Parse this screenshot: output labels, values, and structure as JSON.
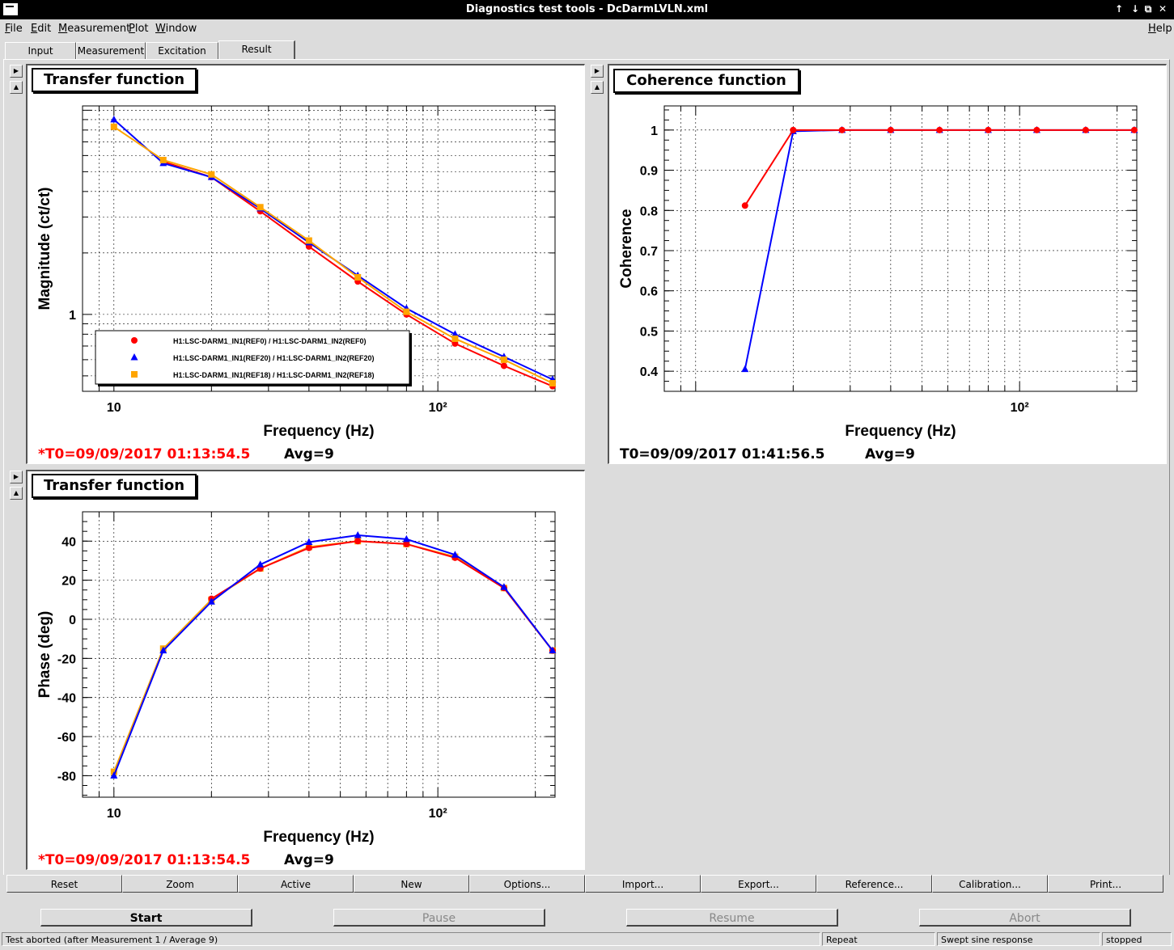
{
  "window": {
    "title": "Diagnostics test tools - DcDarmLVLN.xml",
    "controls": [
      "↑",
      "↓",
      "⧉",
      "✕"
    ]
  },
  "menu": [
    "File",
    "Edit",
    "Measurement",
    "Plot",
    "Window",
    "Help"
  ],
  "tabs": [
    "Input",
    "Measurement",
    "Excitation",
    "Result"
  ],
  "active_tab": "Result",
  "panels": {
    "tf_mag": {
      "title": "Transfer function",
      "t0": "*T0=09/09/2017 01:13:54.5",
      "avg": "Avg=9",
      "t0_color": "#ff0000"
    },
    "coh": {
      "title": "Coherence function",
      "t0": "T0=09/09/2017 01:41:56.5",
      "avg": "Avg=9",
      "t0_color": "#000000"
    },
    "tf_phase": {
      "title": "Transfer function",
      "t0": "*T0=09/09/2017 01:13:54.5",
      "avg": "Avg=9",
      "t0_color": "#ff0000"
    }
  },
  "chart_data": [
    {
      "type": "line",
      "xlabel": "Frequency (Hz)",
      "ylabel": "Magnitude (ct/ct)",
      "xscale": "log",
      "yscale": "log",
      "xlim": [
        8,
        230
      ],
      "ylim": [
        0.42,
        10.5
      ],
      "x_tick_labels": [
        "10",
        "10²"
      ],
      "y_tick_labels": [
        "1"
      ],
      "x": [
        10,
        14.2,
        20,
        28.3,
        40,
        56.6,
        80,
        113,
        160,
        226
      ],
      "series": [
        {
          "name": "H1:LSC-DARM1_IN1(REF0) / H1:LSC-DARM1_IN2(REF0)",
          "color": "#ff0000",
          "marker": "circle",
          "values": [
            null,
            5.6,
            4.7,
            3.2,
            2.15,
            1.45,
            1.0,
            0.72,
            0.56,
            0.445
          ]
        },
        {
          "name": "H1:LSC-DARM1_IN1(REF20) / H1:LSC-DARM1_IN2(REF20)",
          "color": "#0000ff",
          "marker": "triangle",
          "values": [
            9.0,
            5.5,
            4.7,
            3.3,
            2.25,
            1.55,
            1.07,
            0.8,
            0.62,
            0.48
          ]
        },
        {
          "name": "H1:LSC-DARM1_IN1(REF18) / H1:LSC-DARM1_IN2(REF18)",
          "color": "#ffa500",
          "marker": "square",
          "values": [
            8.3,
            5.7,
            4.85,
            3.35,
            2.3,
            1.52,
            1.03,
            0.76,
            0.6,
            0.46
          ]
        }
      ],
      "legend_position": "bottom-left",
      "grid": true
    },
    {
      "type": "line",
      "xlabel": "Frequency (Hz)",
      "ylabel": "Coherence",
      "xscale": "log",
      "xlim": [
        8,
        230
      ],
      "ylim": [
        0.35,
        1.06
      ],
      "x_tick_labels": [
        "10²"
      ],
      "y_ticks": [
        0.4,
        0.5,
        0.6,
        0.7,
        0.8,
        0.9,
        1
      ],
      "x": [
        14.2,
        20,
        28.3,
        40,
        56.6,
        80,
        113,
        160,
        226
      ],
      "series": [
        {
          "color": "#0000ff",
          "marker": "triangle",
          "values": [
            0.405,
            0.997,
            1.0,
            1.0,
            1.0,
            1.0,
            1.0,
            1.0,
            1.0
          ]
        },
        {
          "color": "#ff0000",
          "marker": "circle",
          "values": [
            0.812,
            1.0,
            1.0,
            1.0,
            1.0,
            1.0,
            1.0,
            1.0,
            1.0
          ]
        }
      ],
      "grid": true
    },
    {
      "type": "line",
      "xlabel": "Frequency (Hz)",
      "ylabel": "Phase (deg)",
      "xscale": "log",
      "xlim": [
        8,
        230
      ],
      "ylim": [
        -91,
        55
      ],
      "x_tick_labels": [
        "10",
        "10²"
      ],
      "y_ticks": [
        -80,
        -60,
        -40,
        -20,
        0,
        20,
        40
      ],
      "x": [
        10,
        14.2,
        20,
        28.3,
        40,
        56.6,
        80,
        113,
        160,
        226
      ],
      "series": [
        {
          "color": "#ffa500",
          "marker": "square",
          "values": [
            -78,
            -15,
            10,
            26,
            37,
            40,
            38.5,
            32,
            16,
            -16
          ]
        },
        {
          "color": "#ff0000",
          "marker": "circle",
          "values": [
            null,
            null,
            10.5,
            26,
            36.5,
            40,
            38.5,
            31.5,
            16,
            -16
          ]
        },
        {
          "color": "#0000ff",
          "marker": "triangle",
          "values": [
            -80,
            -16,
            9,
            28,
            39.5,
            43,
            41,
            33,
            16.5,
            -16
          ]
        }
      ],
      "grid": true
    }
  ],
  "toolbar": [
    "Reset",
    "Zoom",
    "Active",
    "New",
    "Options...",
    "Import...",
    "Export...",
    "Reference...",
    "Calibration...",
    "Print..."
  ],
  "actions": {
    "start": "Start",
    "pause": "Pause",
    "resume": "Resume",
    "abort": "Abort"
  },
  "status": {
    "message": "Test aborted (after Measurement 1 / Average 9)",
    "mode": "Repeat",
    "type": "Swept sine response",
    "state": "stopped"
  }
}
